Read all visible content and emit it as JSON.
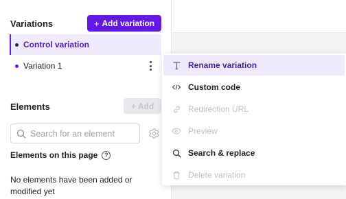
{
  "variations": {
    "title": "Variations",
    "add_button_label": "Add variation",
    "items": [
      {
        "label": "Control variation"
      },
      {
        "label": "Variation 1"
      }
    ]
  },
  "elements": {
    "title": "Elements",
    "add_button_label": "Add",
    "search_placeholder": "Search for an element",
    "on_page_label": "Elements on this page",
    "help_glyph": "?",
    "empty_message": "No elements have been added or modified yet"
  },
  "context_menu": {
    "items": [
      {
        "label": "Rename variation",
        "icon": "text-icon",
        "state": "highlighted"
      },
      {
        "label": "Custom code",
        "icon": "code-icon",
        "state": "enabled"
      },
      {
        "label": "Redirection URL",
        "icon": "link-icon",
        "state": "disabled"
      },
      {
        "label": "Preview",
        "icon": "eye-icon",
        "state": "disabled"
      },
      {
        "label": "Search & replace",
        "icon": "search-icon",
        "state": "enabled"
      },
      {
        "label": "Delete variation",
        "icon": "trash-icon",
        "state": "disabled"
      }
    ]
  },
  "colors": {
    "accent": "#6418e6",
    "highlight_bg": "#efeafb",
    "disabled_text": "#bfbfc6"
  }
}
